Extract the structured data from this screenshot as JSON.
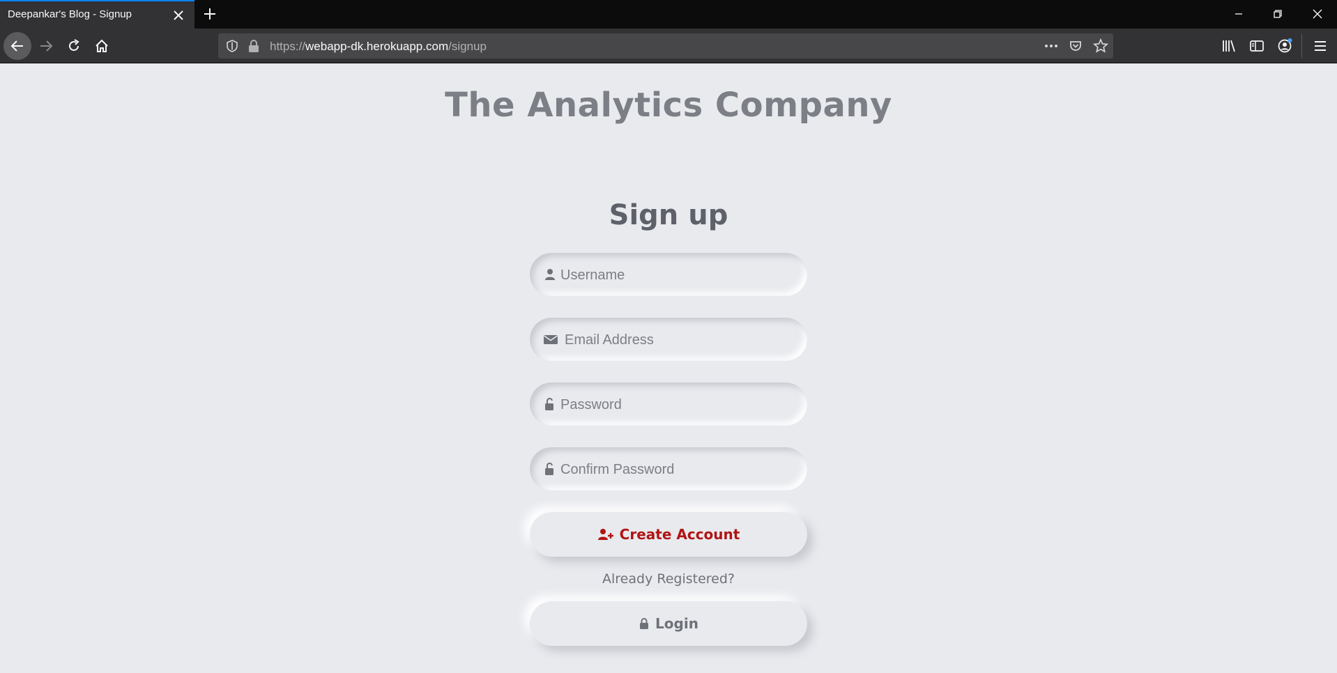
{
  "browser": {
    "tab_title": "Deepankar's Blog - Signup",
    "url": {
      "protocol": "https://",
      "host": "webapp-dk.herokuapp.com",
      "path": "/signup"
    }
  },
  "page": {
    "brand": "The Analytics Company",
    "heading": "Sign up",
    "fields": {
      "username": {
        "placeholder": "Username",
        "icon": "user-icon"
      },
      "email": {
        "placeholder": "Email Address",
        "icon": "envelope-icon"
      },
      "password": {
        "placeholder": "Password",
        "icon": "unlock-icon"
      },
      "confirm_password": {
        "placeholder": "Confirm Password",
        "icon": "unlock-icon"
      }
    },
    "create_button": {
      "label": "Create Account",
      "icon": "user-plus-icon"
    },
    "already_registered": "Already Registered?",
    "login_button": {
      "label": "Login",
      "icon": "lock-icon"
    }
  },
  "colors": {
    "background": "#e9eaee",
    "brand_text": "#7c7f85",
    "accent_red": "#b11414",
    "tab_accent": "#0a84ff"
  }
}
